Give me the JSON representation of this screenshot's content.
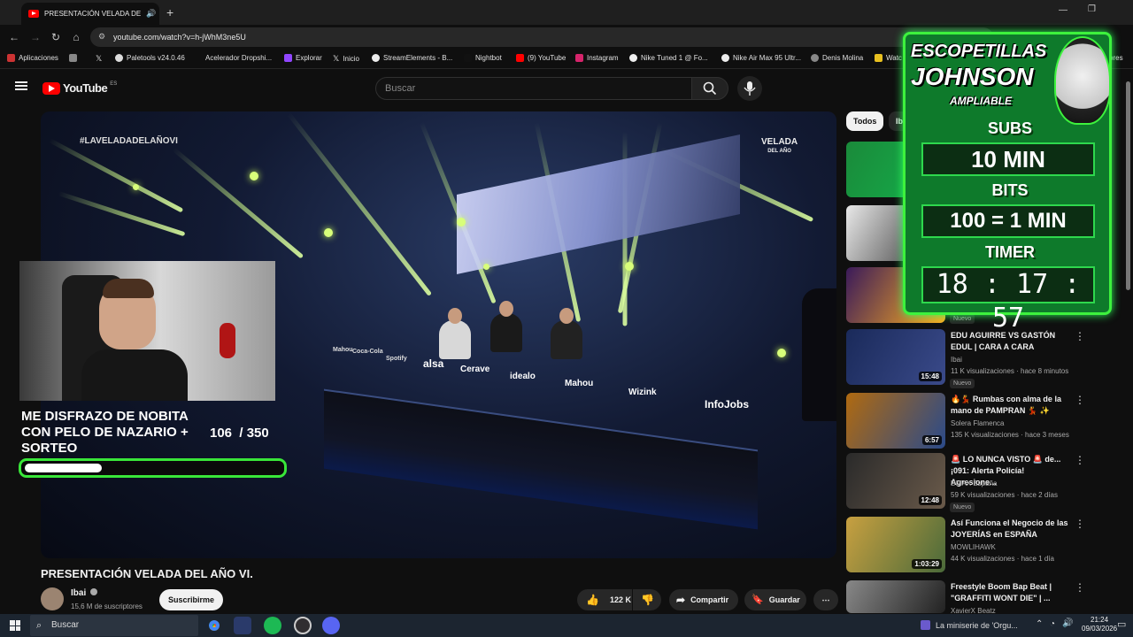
{
  "browser": {
    "tab_title": "PRESENTACIÓN VELADA DE",
    "url": "youtube.com/watch?v=h-jWhM3ne5U",
    "bookmarks": [
      "Aplicaciones",
      "Paletools v24.0.46",
      "Acelerador Dropshi...",
      "Explorar",
      "Inicio",
      "StreamElements - B...",
      "Nightbot",
      "(9) YouTube",
      "Instagram",
      "Nike Tuned 1 @ Fo...",
      "Nike Air Max 95 Ultr...",
      "Denis Molina",
      "Watc",
      "ores"
    ]
  },
  "youtube": {
    "logo": "YouTube",
    "region": "ES",
    "search_placeholder": "Buscar"
  },
  "video": {
    "hashtag": "#LAVELADADELAÑOVI",
    "brand_top": "VELADA",
    "brand_bottom": "DEL AÑO",
    "sponsors": [
      "Mahou",
      "Coca-Cola",
      "Spotify",
      "alsa",
      "Cerave",
      "idealo",
      "Mahou",
      "Wizink",
      "InfoJobs"
    ],
    "goal_text": "ME DISFRAZO DE NOBITA CON PELO DE NAZARIO + SORTEO",
    "goal_count": "106",
    "goal_total": "/ 350",
    "goal_progress": 0.3
  },
  "overlay": {
    "name_line1": "ESCOPETILLAS",
    "name_line2": "JOHNSON",
    "tagline": "AMPLIABLE",
    "subs_label": "SUBS",
    "subs_value": "10 MIN",
    "bits_label": "BITS",
    "bits_value": "100 = 1 MIN",
    "timer_label": "TIMER",
    "timer_value": "18 : 17 : 57"
  },
  "video_info": {
    "title": "PRESENTACIÓN VELADA DEL AÑO VI.",
    "channel": "Ibai",
    "subscribers": "15,6 M de suscriptores",
    "subscribe_label": "Suscribirme",
    "likes": "122 K",
    "share_label": "Compartir",
    "save_label": "Guardar"
  },
  "sidebar": {
    "chips": [
      "Todos",
      "Iba"
    ],
    "recommendations": [
      {
        "title": "",
        "channel": "",
        "meta": "",
        "badge": "",
        "duration": "",
        "colors": [
          "#1a8a3a",
          "#14b04c"
        ]
      },
      {
        "title": "",
        "channel": "",
        "meta": "",
        "badge": "",
        "duration": "",
        "colors": [
          "#e8e8e8",
          "#2a2a2a"
        ]
      },
      {
        "title": "",
        "channel": "",
        "meta": "",
        "badge": "Nuevo",
        "duration": "",
        "colors": [
          "#3a1a5a",
          "#ffb020"
        ]
      },
      {
        "title": "EDU AGUIRRE VS GASTÓN EDUL | CARA A CARA",
        "channel": "Ibai",
        "meta": "11 K visualizaciones · hace 8 minutos",
        "badge": "Nuevo",
        "duration": "15:48",
        "colors": [
          "#1a2a5a",
          "#3a4a8a"
        ]
      },
      {
        "title": "🔥💃 Rumbas con alma de la mano de PAMPRAN 💃 ✨",
        "channel": "Solera Flamenca",
        "meta": "135 K visualizaciones · hace 3 meses",
        "badge": "",
        "duration": "6:57",
        "colors": [
          "#b06a10",
          "#2a4a8a"
        ]
      },
      {
        "title": "🚨 LO NUNCA VISTO 🚨 de... ¡091: Alerta Policía! Agresione...",
        "channel": "DMAX España",
        "meta": "59 K visualizaciones · hace 2 días",
        "badge": "Nuevo",
        "duration": "12:48",
        "colors": [
          "#2a2a2a",
          "#6a5a4a"
        ]
      },
      {
        "title": "Así Funciona el Negocio de las JOYERÍAS en ESPAÑA",
        "channel": "MOWLIHAWK",
        "meta": "44 K visualizaciones · hace 1 día",
        "badge": "",
        "duration": "1:03:29",
        "colors": [
          "#c8a040",
          "#4a6a3a"
        ]
      },
      {
        "title": "Freestyle Boom Bap Beat | \"GRAFFITI WONT DIE\" | ...",
        "channel": "XavierX Beatz",
        "meta": "",
        "badge": "",
        "duration": "",
        "colors": [
          "#888888",
          "#222222"
        ]
      }
    ]
  },
  "taskbar": {
    "search_label": "Buscar",
    "now_playing": "La miniserie de 'Orgu...",
    "time": "21:24",
    "date": "09/03/2026"
  },
  "colors": {
    "accent_green": "#3df23d",
    "youtube_red": "#ff0000",
    "background": "#0f0f0f"
  }
}
